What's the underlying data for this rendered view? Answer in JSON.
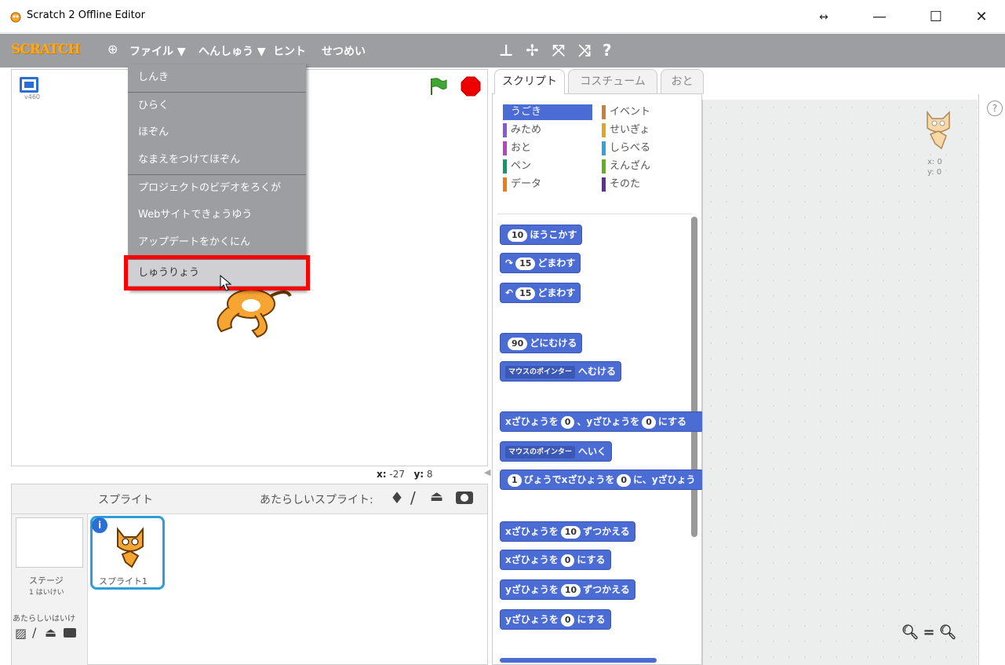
{
  "window": {
    "title": "Scratch 2 Offline Editor",
    "resize_glyph": "↔",
    "minimize": "—",
    "maximize": "☐",
    "close": "✕"
  },
  "menubar": {
    "logo": "SCRATCH",
    "globe": "⊕",
    "file": "ファイル ▼",
    "edit": "へんしゅう ▼",
    "hint": "ヒント",
    "about": "せつめい",
    "tools": [
      "duplicate-icon",
      "delete-icon",
      "grow-icon",
      "shrink-icon",
      "help-icon"
    ]
  },
  "file_menu": {
    "items": [
      "しんき",
      "ひらく",
      "ほぞん",
      "なまえをつけてほぞん",
      "プロジェクトのビデオをろくが",
      "Webサイトできょうゆう",
      "アップデートをかくにん",
      "しゅうりょう"
    ],
    "highlighted": "しゅうりょう"
  },
  "stage": {
    "version": "v460",
    "coords_x_label": "x:",
    "coords_x": "-27",
    "coords_y_label": "y:",
    "coords_y": "8"
  },
  "sprite_pane": {
    "title": "スプライト",
    "new_sprite": "あたらしいスプライト:",
    "stage_label": "ステージ",
    "stage_sub": "1 はいけい",
    "new_backdrop": "あたらしいはいけ",
    "sprite1": "スプライト1",
    "info": "i"
  },
  "tabs": [
    "スクリプト",
    "コスチューム",
    "おと"
  ],
  "categories": [
    {
      "label": "うごき",
      "color": "#4a6cd4"
    },
    {
      "label": "イベント",
      "color": "#c88330"
    },
    {
      "label": "みため",
      "color": "#8a55d7"
    },
    {
      "label": "せいぎょ",
      "color": "#e1a91a"
    },
    {
      "label": "おと",
      "color": "#bb42c3"
    },
    {
      "label": "しらべる",
      "color": "#2ca5e2"
    },
    {
      "label": "ペン",
      "color": "#0e9a6c"
    },
    {
      "label": "えんざん",
      "color": "#5cb712"
    },
    {
      "label": "データ",
      "color": "#ee7d16"
    },
    {
      "label": "そのた",
      "color": "#632d99"
    }
  ],
  "blocks": {
    "move_n": "10",
    "move": "ほうこかす",
    "turn_n": "15",
    "turn": "どまわす",
    "turn2_n": "15",
    "turn2": "どまわす",
    "point_n": "90",
    "point": "どにむける",
    "pointto_dd": "マウスのポインター",
    "pointto": "へむける",
    "goto_x": "xざひょうを",
    "goto_xv": "0",
    "goto_sep": "、yざひょうを",
    "goto_yv": "0",
    "goto_end": "にする",
    "gotomouse_dd": "マウスのポインター",
    "gotomouse": "へいく",
    "glide_n": "1",
    "glide": "びょうでxざひょうを",
    "glide_x": "0",
    "glide_mid": "に、yざひょう",
    "changex_pre": "xざひょうを",
    "changex_n": "10",
    "changex": "ずつかえる",
    "setx_pre": "xざひょうを",
    "setx_n": "0",
    "setx": "にする",
    "changey_pre": "yざひょうを",
    "changey_n": "10",
    "changey": "ずつかえる",
    "sety_pre": "yざひょうを",
    "sety_n": "0",
    "sety": "にする"
  },
  "scripts": {
    "x_label": "x: 0",
    "y_label": "y: 0",
    "zoom_out": "−",
    "zoom_reset": "=",
    "zoom_in": "+",
    "help": "?"
  }
}
